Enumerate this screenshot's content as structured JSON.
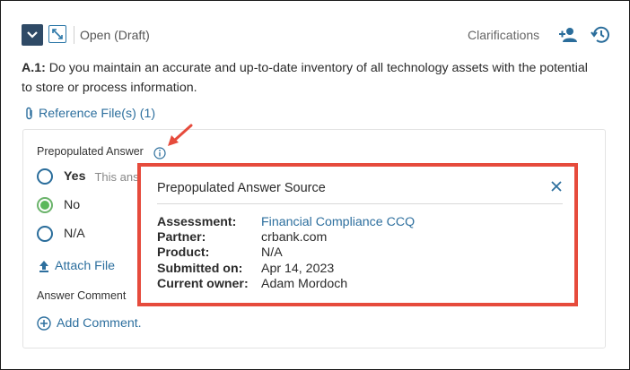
{
  "header": {
    "status": "Open (Draft)",
    "clarifications_label": "Clarifications"
  },
  "question": {
    "id": "A.1:",
    "text": "Do you maintain an accurate and up-to-date inventory of all technology assets with the potential to store or process information."
  },
  "reference_files": {
    "label": "Reference File(s) (1)"
  },
  "answer": {
    "prepopulated_label": "Prepopulated Answer",
    "options": [
      {
        "label": "Yes",
        "note": "This answ",
        "selected": false
      },
      {
        "label": "No",
        "selected": true
      },
      {
        "label": "N/A",
        "selected": false
      }
    ],
    "attach_label": "Attach File",
    "comment_label": "Answer Comment",
    "add_comment_label": "Add Comment."
  },
  "popover": {
    "title": "Prepopulated Answer Source",
    "rows": [
      {
        "key": "Assessment:",
        "value": "Financial Compliance CCQ",
        "link": true
      },
      {
        "key": "Partner:",
        "value": "crbank.com",
        "link": false
      },
      {
        "key": "Product:",
        "value": "N/A",
        "link": false
      },
      {
        "key": "Submitted on:",
        "value": "Apr 14, 2023",
        "link": false
      },
      {
        "key": "Current owner:",
        "value": "Adam Mordoch",
        "link": false
      }
    ]
  },
  "colors": {
    "link": "#2d6f9e",
    "highlight": "#e64b3c",
    "selected_radio": "#5cb85c",
    "header_button": "#2f4a66"
  }
}
